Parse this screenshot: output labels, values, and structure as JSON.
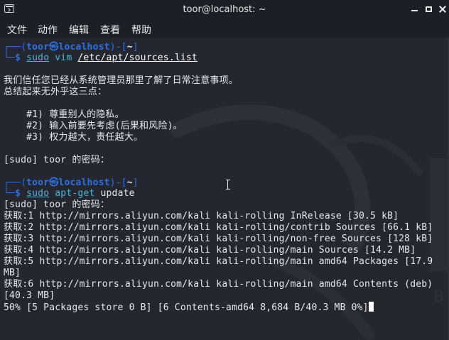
{
  "window": {
    "title": "toor@localhost: ~"
  },
  "menu": [
    "文件",
    "动作",
    "编辑",
    "查看",
    "帮助"
  ],
  "prompt1": {
    "top": "┌──(",
    "user": "toor",
    "at": "㉿",
    "host": "localhost",
    "mid": ")-[",
    "cwd": "~",
    "end": "]",
    "dollar_prefix": "└─",
    "dollar": "$ ",
    "cmd_sudo": "sudo",
    "cmd_vim": "vim",
    "cmd_path": "/etc/apt/sources.list"
  },
  "lecture": [
    "我们信任您已经从系统管理员那里了解了日常注意事项。",
    "总结起来无外乎这三点：",
    "",
    "    #1) 尊重别人的隐私。",
    "    #2) 输入前要先考虑(后果和风险)。",
    "    #3) 权力越大，责任越大。",
    "",
    "[sudo] toor 的密码："
  ],
  "prompt2": {
    "top": "┌──(",
    "user": "toor",
    "at": "㉿",
    "host": "localhost",
    "mid": ")-[",
    "cwd": "~",
    "end": "]",
    "dollar_prefix": "└─",
    "dollar": "$ ",
    "cmd_sudo": "sudo",
    "cmd_aptget": "apt-get",
    "cmd_arg": "update"
  },
  "output": [
    "[sudo] toor 的密码：",
    "获取:1 http://mirrors.aliyun.com/kali kali-rolling InRelease [30.5 kB]",
    "获取:2 http://mirrors.aliyun.com/kali kali-rolling/contrib Sources [66.1 kB]",
    "获取:3 http://mirrors.aliyun.com/kali kali-rolling/non-free Sources [128 kB]",
    "获取:4 http://mirrors.aliyun.com/kali kali-rolling/main Sources [14.2 MB]",
    "获取:5 http://mirrors.aliyun.com/kali kali-rolling/main amd64 Packages [17.9",
    "MB]",
    "获取:6 http://mirrors.aliyun.com/kali kali-rolling/main amd64 Contents (deb)",
    "[40.3 MB]",
    "50% [5 Packages store 0 B] [6 Contents-amd64 8,684 B/40.3 MB 0%]"
  ],
  "colors": {
    "background": "#24272f",
    "titlebar": "#1c1f25",
    "prompt_blue": "#2f6fe2",
    "command_cyan": "#3fb9d6",
    "text": "#e6e8ec"
  },
  "icons": {
    "app": "terminal-icon",
    "minimize": "minimize-icon",
    "maximize": "maximize-icon",
    "close": "close-icon"
  }
}
